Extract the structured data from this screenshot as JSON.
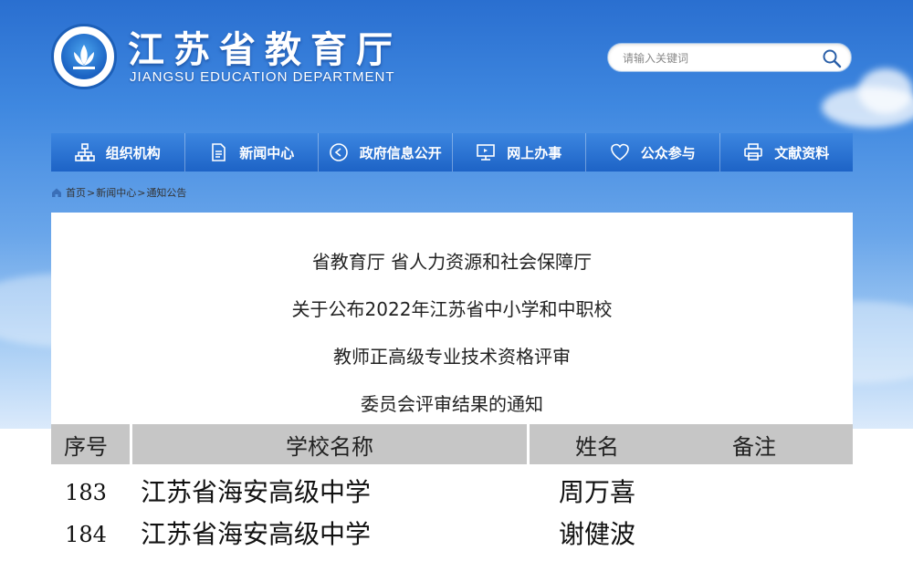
{
  "header": {
    "site_title": "江苏省教育厅",
    "site_subtitle": "JIANGSU EDUCATION DEPARTMENT",
    "search_placeholder": "请输入关键词"
  },
  "nav": {
    "items": [
      {
        "label": "组织机构",
        "icon": "org-chart-icon"
      },
      {
        "label": "新闻中心",
        "icon": "document-icon"
      },
      {
        "label": "政府信息公开",
        "icon": "play-circle-icon"
      },
      {
        "label": "网上办事",
        "icon": "monitor-icon"
      },
      {
        "label": "公众参与",
        "icon": "heart-icon"
      },
      {
        "label": "文献资料",
        "icon": "printer-icon"
      }
    ]
  },
  "breadcrumb": {
    "home": "首页",
    "news": "新闻中心",
    "current": "通知公告"
  },
  "article": {
    "title_lines": [
      "省教育厅 省人力资源和社会保障厅",
      "关于公布2022年江苏省中小学和中职校",
      "教师正高级专业技术资格评审",
      "委员会评审结果的通知"
    ]
  },
  "table": {
    "headers": [
      "序号",
      "学校名称",
      "姓名",
      "备注"
    ],
    "rows": [
      {
        "no": "183",
        "school": "江苏省海安高级中学",
        "name": "周万喜",
        "note": ""
      },
      {
        "no": "184",
        "school": "江苏省海安高级中学",
        "name": "谢健波",
        "note": ""
      }
    ]
  },
  "colors": {
    "nav_top": "#3c86e0",
    "nav_bottom": "#1d63c6",
    "table_header": "#c6c6c6"
  }
}
